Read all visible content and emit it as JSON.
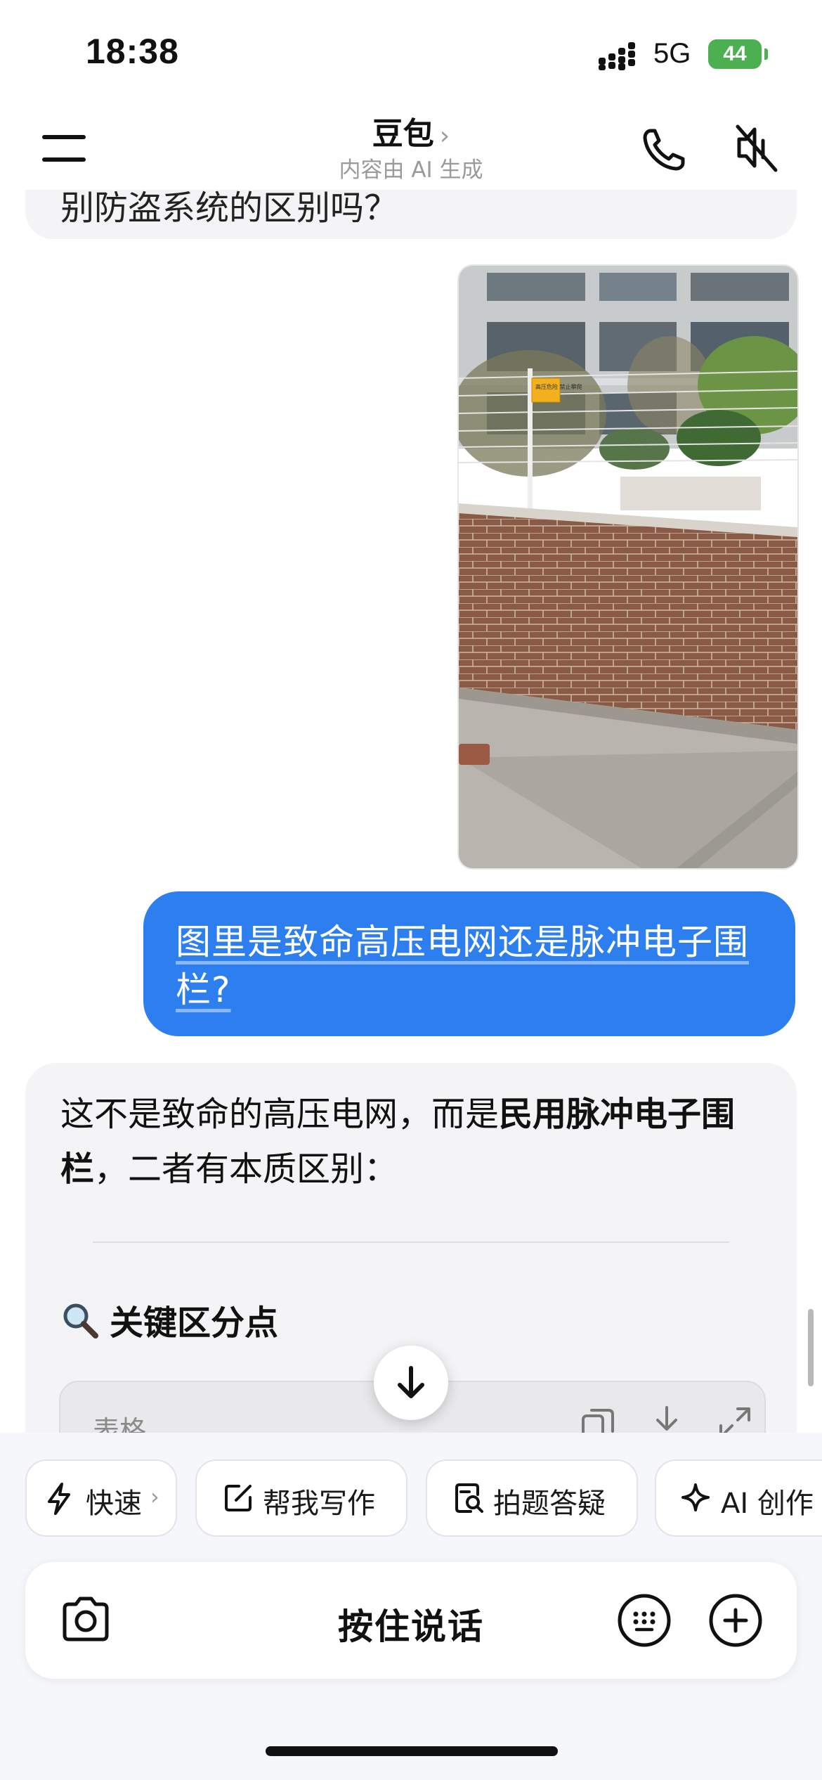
{
  "status_bar": {
    "time": "18:38",
    "network": "5G",
    "battery": "44"
  },
  "header": {
    "title": "豆包",
    "chevron": "›",
    "subtitle": "内容由 AI 生成"
  },
  "chat": {
    "previous_message_fragment": "别防盗系统的区别吗？",
    "user_message": "图里是致命高压电网还是脉冲电子围栏?",
    "ai_intro_plain_1": "这不是致命的高压电网，而是",
    "ai_intro_bold": "民用脉冲电子围栏",
    "ai_intro_plain_2": "，二者有本质区别：",
    "ai_section_heading": "关键区分点",
    "table_label": "表格",
    "photo_sign_text": "高压危险 禁止攀爬"
  },
  "quick_actions": [
    {
      "label": "快速",
      "icon": "lightning-icon"
    },
    {
      "label": "帮我写作",
      "icon": "edit-icon"
    },
    {
      "label": "拍题答疑",
      "icon": "photo-search-icon"
    },
    {
      "label": "AI 创作",
      "icon": "sparkle-icon"
    }
  ],
  "input": {
    "voice_label": "按住说话"
  },
  "colors": {
    "accent_blue": "#2d7ff0",
    "battery_green": "#4caf50",
    "bubble_gray": "#f4f4f6"
  }
}
